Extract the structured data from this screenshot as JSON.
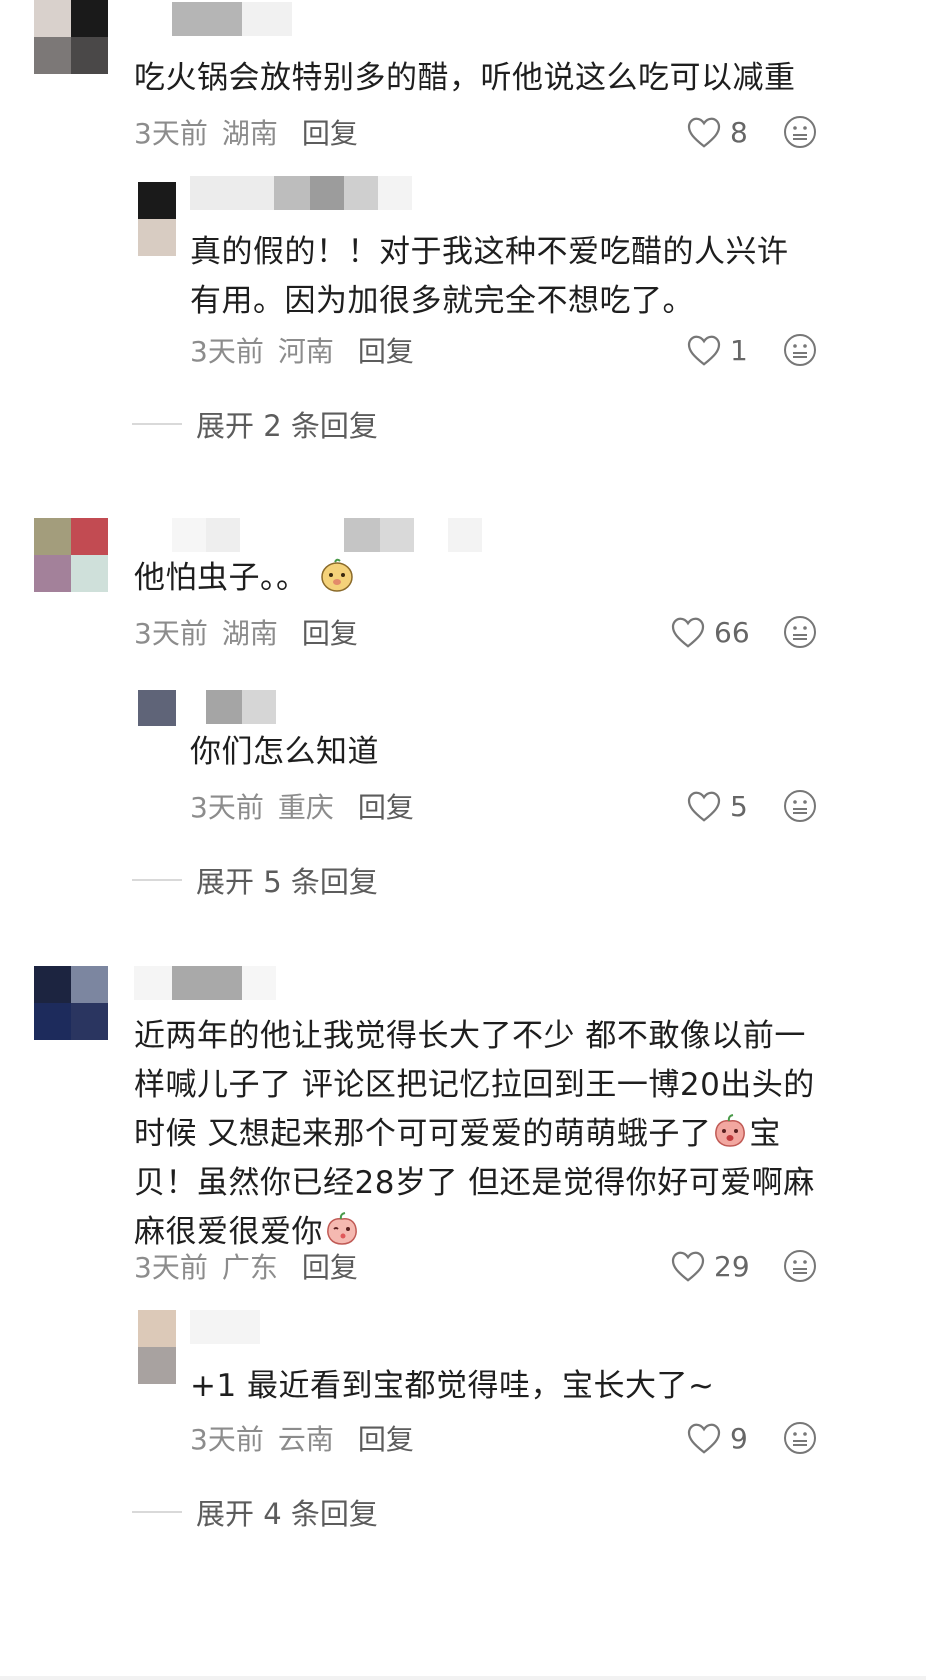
{
  "comments": [
    {
      "text": "吃火锅会放特别多的醋，听他说这么吃可以减重",
      "time": "3天前",
      "region": "湖南",
      "reply": "回复",
      "likes": "8",
      "sub": {
        "text_line1": "真的假的！！对于我这种不爱吃醋的人兴许",
        "text_line2": "有用。因为加很多就完全不想吃了。",
        "time": "3天前",
        "region": "河南",
        "reply": "回复",
        "likes": "1"
      },
      "expand": "展开 2 条回复"
    },
    {
      "text": "他怕虫子。。",
      "time": "3天前",
      "region": "湖南",
      "reply": "回复",
      "likes": "66",
      "sub": {
        "text_line1": "你们怎么知道",
        "time": "3天前",
        "region": "重庆",
        "reply": "回复",
        "likes": "5"
      },
      "expand": "展开 5 条回复"
    },
    {
      "text_line1": "近两年的他让我觉得长大了不少 都不敢像以前一",
      "text_line2": "样喊儿子了 评论区把记忆拉回到王一博20出头的",
      "text_line3": "时候 又想起来那个可可爱爱的萌萌蛾子了",
      "text_line3b": "宝",
      "text_line4": "贝！虽然你已经28岁了 但还是觉得你好可爱啊麻",
      "text_line5": "麻很爱很爱你",
      "time": "3天前",
      "region": "广东",
      "reply": "回复",
      "likes": "29",
      "sub": {
        "text_line1": "+1 最近看到宝都觉得哇，宝长大了~",
        "time": "3天前",
        "region": "云南",
        "reply": "回复",
        "likes": "9"
      },
      "expand": "展开 4 条回复"
    }
  ],
  "icons": {
    "like": "heart-outline-icon",
    "emoji": "neutral-face-icon"
  },
  "colors": {
    "text": "#1e1e1e",
    "meta": "#8c8c8c",
    "reply": "#5c5c5c"
  }
}
